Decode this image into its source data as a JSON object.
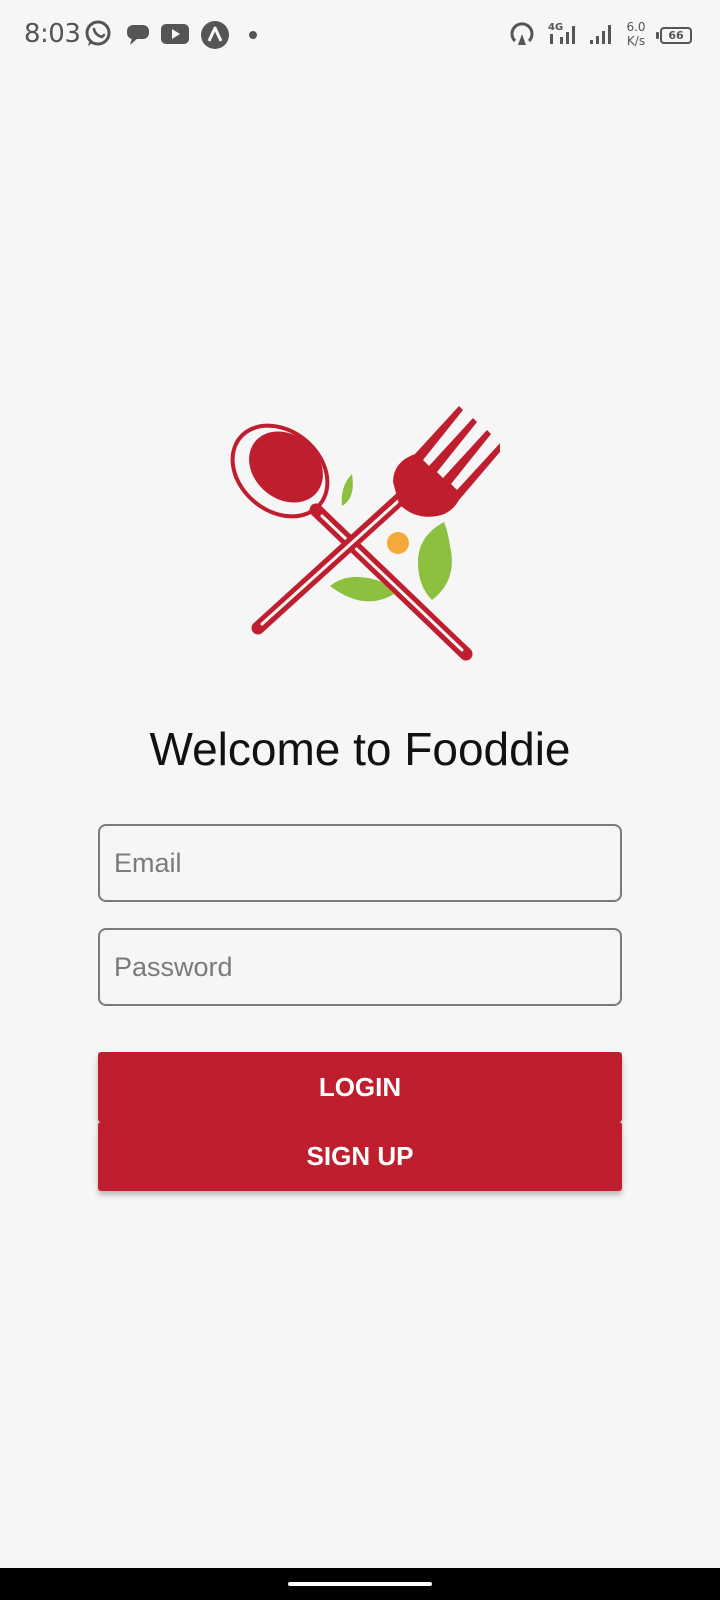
{
  "status_bar": {
    "time": "8:03",
    "icons": [
      "whatsapp-icon",
      "chat-icon",
      "youtube-icon",
      "caret-icon",
      "dot-icon",
      "hotspot-icon",
      "4g-signal-icon",
      "signal-icon"
    ],
    "net_speed_value": "6.0",
    "net_speed_unit": "K/s",
    "battery": "66"
  },
  "logo": {
    "icon": "spoon-fork-icon",
    "colors": {
      "utensil": "#be1e2d",
      "leaf": "#8dc03f",
      "dot": "#f5a93a"
    }
  },
  "title": "Welcome to Fooddie",
  "form": {
    "email_placeholder": "Email",
    "email_value": "",
    "password_placeholder": "Password",
    "password_value": "",
    "login_label": "LOGIN",
    "signup_label": "SIGN UP"
  },
  "colors": {
    "background": "#f6f6f6",
    "primary": "#be1e2d",
    "field_border": "#7a7a7a"
  }
}
